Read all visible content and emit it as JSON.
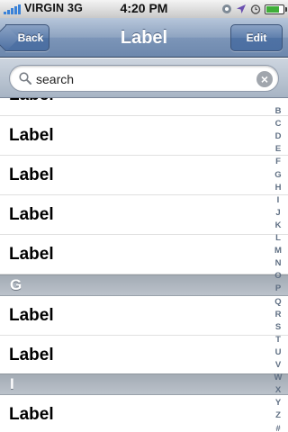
{
  "status_bar": {
    "carrier": "VIRGIN",
    "network": "3G",
    "time": "4:20 PM",
    "signal_bars": 5,
    "battery_level": 0.85,
    "icons": [
      "lock-rotation-icon",
      "location-arrow-icon",
      "alarm-icon",
      "battery-icon"
    ]
  },
  "nav_bar": {
    "title": "Label",
    "back_label": "Back",
    "edit_label": "Edit"
  },
  "search": {
    "value": "search",
    "placeholder": "search"
  },
  "list": {
    "partial_top_label": "Label",
    "sections": [
      {
        "header": "",
        "items": [
          "Label",
          "Label",
          "Label",
          "Label"
        ]
      },
      {
        "header": "G",
        "items": [
          "Label",
          "Label"
        ]
      },
      {
        "header": "I",
        "items": [
          "Label"
        ]
      }
    ]
  },
  "index": [
    "B",
    "C",
    "D",
    "E",
    "F",
    "G",
    "H",
    "I",
    "J",
    "K",
    "L",
    "M",
    "N",
    "O",
    "P",
    "Q",
    "R",
    "S",
    "T",
    "U",
    "V",
    "W",
    "X",
    "Y",
    "Z",
    "#"
  ],
  "colors": {
    "nav_bar": "#7c95b8",
    "section_header": "#a7afb8",
    "index_text": "#5f6f83",
    "signal": "#3a82d8",
    "battery": "#3fae39"
  }
}
